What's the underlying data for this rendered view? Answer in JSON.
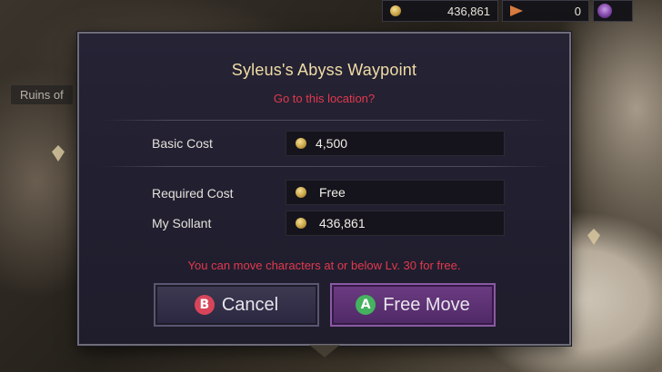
{
  "background": {
    "map_label": "Ruins of"
  },
  "currency_bar": {
    "gold_icon": "coin-icon",
    "gold_amount": "436,861",
    "ticket_icon": "ticket-icon",
    "ticket_amount": "0",
    "gem_icon": "gem-icon"
  },
  "dialog": {
    "title": "Syleus's Abyss Waypoint",
    "subtitle": "Go to this location?",
    "rows": {
      "basic_cost": {
        "label": "Basic Cost",
        "value": "4,500",
        "icon": "coin-icon"
      },
      "required_cost": {
        "label": "Required Cost",
        "value": "Free",
        "icon": "coin-icon"
      },
      "my_sollant": {
        "label": "My Sollant",
        "value": "436,861",
        "icon": "coin-icon"
      }
    },
    "notice": "You can move characters at or below Lv. 30 for free.",
    "buttons": {
      "cancel": {
        "badge": "B",
        "label": "Cancel",
        "badge_color": "#d8455a"
      },
      "free_move": {
        "badge": "A",
        "label": "Free Move",
        "badge_color": "#45b25f"
      }
    }
  },
  "colors": {
    "title_gold": "#f0dca6",
    "warning_red": "#e2384e",
    "dialog_bg": "#252334",
    "primary_button": "#6c3b82"
  }
}
